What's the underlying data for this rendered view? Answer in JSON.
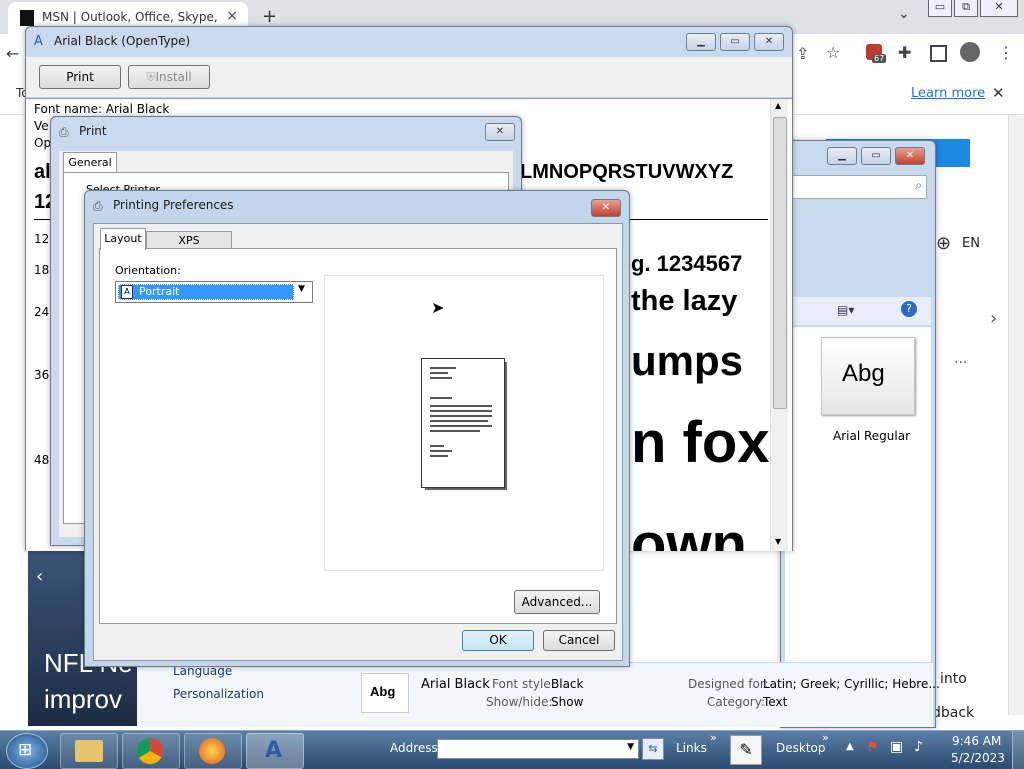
{
  "chrome": {
    "tab_title": "MSN | Outlook, Office, Skype, Bi",
    "tab_close": "×",
    "new_tab": "+",
    "tab_list": "⌄",
    "ctrl_min": "▭",
    "ctrl_max": "⧉",
    "ctrl_close": "✕",
    "ext_badge": "67",
    "infobar_prefix": "To",
    "learn_more": "Learn more",
    "infobar_close": "✕"
  },
  "msn": {
    "lang": "EN",
    "more": "···",
    "headline_line1": "NFL Ne",
    "headline_line2": "improv",
    "right_snip1": "into",
    "right_snip2": "dback"
  },
  "font_viewer": {
    "title": "Arial Black (OpenType)",
    "print_label": "Print",
    "install_label": "Install",
    "font_name_line": "Font name: Arial Black",
    "ver_snip": "Ve",
    "op_snip": "Op",
    "al_snip": "al",
    "twelve_snip": "12",
    "alphabet": "LMNOPQRSTUVWXYZ",
    "sizes": [
      "12",
      "18",
      "24",
      "36",
      "48"
    ],
    "sample1": "g. 1234567",
    "sample2": "the lazy",
    "sample3": "umps",
    "sample4": "n fox",
    "sample5": "own"
  },
  "explorer": {
    "tile_text": "Abg",
    "tile_label": "Arial Regular",
    "details_name": "Arial Black",
    "font_style_label": "Font style:",
    "font_style_value": "Black",
    "showhide_label": "Show/hide:",
    "showhide_value": "Show",
    "designed_label": "Designed for:",
    "designed_value": "Latin; Greek; Cyrillic; Hebre...",
    "category_label": "Category:",
    "category_value": "Text",
    "sidebar_language": "Language",
    "sidebar_personalization": "Personalization",
    "details_thumb": "Abg"
  },
  "print_dialog": {
    "title": "Print",
    "tab_general": "General",
    "select_printer_snip": "Select Printer"
  },
  "prefs": {
    "title": "Printing Preferences",
    "tab_layout": "Layout",
    "tab_xps": "XPS Documents",
    "orientation_label": "Orientation:",
    "orientation_value": "Portrait",
    "advanced_label": "Advanced...",
    "ok_label": "OK",
    "cancel_label": "Cancel"
  },
  "taskbar": {
    "address_label": "Address",
    "links_label": "Links",
    "desktop_label": "Desktop",
    "time": "9:46 AM",
    "date": "5/2/2023",
    "chevron": "»"
  }
}
